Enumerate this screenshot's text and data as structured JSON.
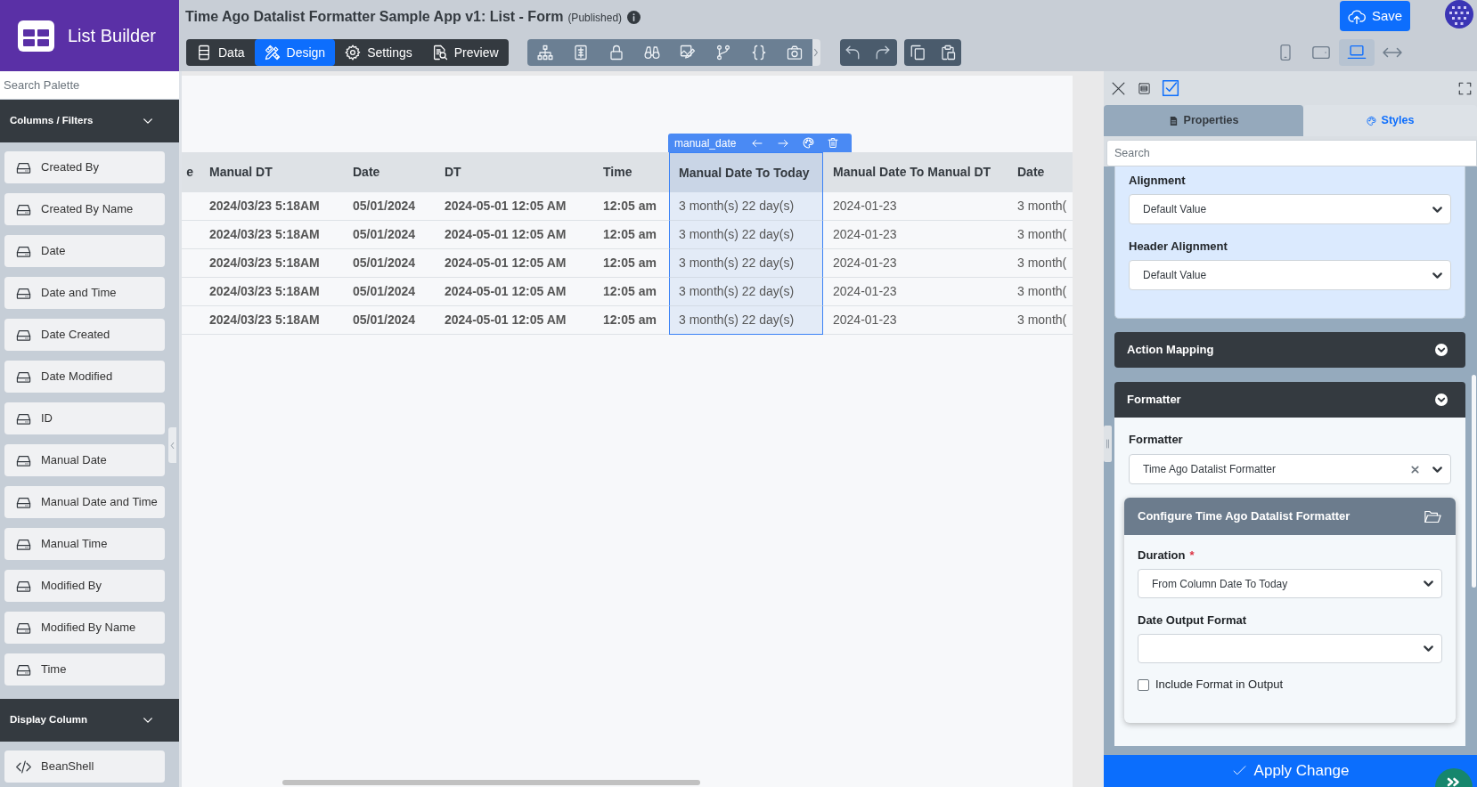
{
  "brand": {
    "title": "List Builder"
  },
  "header": {
    "title": "Time Ago Datalist Formatter Sample App v1: List - Form",
    "status": "(Published)",
    "save_label": "Save"
  },
  "mode_tabs": [
    {
      "label": "Data",
      "selected": false
    },
    {
      "label": "Design",
      "selected": true
    },
    {
      "label": "Settings",
      "selected": false
    },
    {
      "label": "Preview",
      "selected": false
    }
  ],
  "device_buttons": [
    {
      "kind": "phone",
      "selected": false
    },
    {
      "kind": "tablet",
      "selected": false
    },
    {
      "kind": "laptop",
      "selected": true
    },
    {
      "kind": "fluid",
      "selected": false
    }
  ],
  "sidebar": {
    "search": {
      "placeholder": "Search Palette"
    },
    "sections": [
      {
        "title": "Columns / Filters",
        "items": [
          {
            "label": "Created By",
            "kind": "column"
          },
          {
            "label": "Created By Name",
            "kind": "column"
          },
          {
            "label": "Date",
            "kind": "column"
          },
          {
            "label": "Date and Time",
            "kind": "column"
          },
          {
            "label": "Date Created",
            "kind": "column"
          },
          {
            "label": "Date Modified",
            "kind": "column"
          },
          {
            "label": "ID",
            "kind": "column"
          },
          {
            "label": "Manual Date",
            "kind": "column"
          },
          {
            "label": "Manual Date and Time",
            "kind": "column"
          },
          {
            "label": "Manual Time",
            "kind": "column"
          },
          {
            "label": "Modified By",
            "kind": "column"
          },
          {
            "label": "Modified By Name",
            "kind": "column"
          },
          {
            "label": "Time",
            "kind": "column"
          }
        ]
      },
      {
        "title": "Display Column",
        "items": [
          {
            "label": "BeanShell",
            "kind": "code"
          }
        ]
      }
    ]
  },
  "canvas": {
    "column_toolbar": {
      "label": "manual_date"
    },
    "table": {
      "cut_column": {
        "label": "e"
      },
      "columns": [
        {
          "label": "Manual DT",
          "bold": true,
          "selected": false
        },
        {
          "label": "Date",
          "bold": true,
          "selected": false
        },
        {
          "label": "DT",
          "bold": true,
          "selected": false
        },
        {
          "label": "Time",
          "bold": true,
          "selected": false
        },
        {
          "label": "Manual Date To Today",
          "bold": false,
          "selected": true
        },
        {
          "label": "Manual Date To Manual DT",
          "bold": false,
          "selected": false
        },
        {
          "label": "Date",
          "bold": false,
          "selected": false
        }
      ],
      "rows": [
        [
          "2024/03/23 5:18AM",
          "05/01/2024",
          "2024-05-01 12:05 AM",
          "12:05 am",
          "3 month(s) 22 day(s)",
          "2024-01-23",
          "3 month("
        ],
        [
          "2024/03/23 5:18AM",
          "05/01/2024",
          "2024-05-01 12:05 AM",
          "12:05 am",
          "3 month(s) 22 day(s)",
          "2024-01-23",
          "3 month("
        ],
        [
          "2024/03/23 5:18AM",
          "05/01/2024",
          "2024-05-01 12:05 AM",
          "12:05 am",
          "3 month(s) 22 day(s)",
          "2024-01-23",
          "3 month("
        ],
        [
          "2024/03/23 5:18AM",
          "05/01/2024",
          "2024-05-01 12:05 AM",
          "12:05 am",
          "3 month(s) 22 day(s)",
          "2024-01-23",
          "3 month("
        ],
        [
          "2024/03/23 5:18AM",
          "05/01/2024",
          "2024-05-01 12:05 AM",
          "12:05 am",
          "3 month(s) 22 day(s)",
          "2024-01-23",
          "3 month("
        ]
      ]
    }
  },
  "properties_panel": {
    "tabs": [
      {
        "label": "Properties",
        "kind": "properties",
        "selected": true
      },
      {
        "label": "Styles",
        "kind": "styles",
        "selected": false
      }
    ],
    "search": {
      "placeholder": "Search"
    },
    "sections": [
      {
        "kind": "fields",
        "fields": [
          {
            "label": "Alignment",
            "value": "Default Value"
          },
          {
            "label": "Header Alignment",
            "value": "Default Value"
          }
        ]
      },
      {
        "kind": "collapsible",
        "title": "Action Mapping",
        "expanded": false
      },
      {
        "kind": "collapsible",
        "title": "Formatter",
        "expanded": true,
        "fields": [
          {
            "label": "Formatter",
            "value": "Time Ago Datalist Formatter",
            "clearable": true
          }
        ],
        "config": {
          "title": "Configure Time Ago Datalist Formatter",
          "fields": [
            {
              "kind": "select",
              "label": "Duration",
              "required_mark": "*",
              "value": "From Column Date To Today"
            },
            {
              "kind": "select",
              "label": "Date Output Format"
            },
            {
              "kind": "checkbox",
              "label": "Include Format in Output",
              "checked": false
            }
          ]
        }
      }
    ]
  },
  "apply_button": {
    "label": "Apply Change"
  }
}
